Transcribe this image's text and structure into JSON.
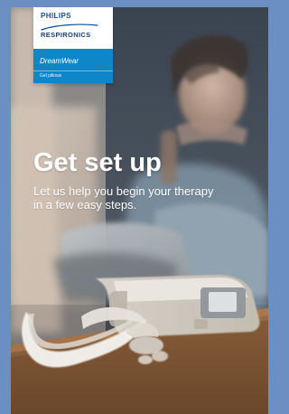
{
  "branding": {
    "company": "PHILIPS",
    "subbrand": "RESPIRONICS",
    "product": "DreamWear",
    "variant": "Gel pillows"
  },
  "hero": {
    "title": "Get set up",
    "subtitle": "Let us help you begin your therapy in a few easy steps."
  },
  "visual": {
    "background_frame": "#6b8fc2",
    "brand_blue": "#0f86c8",
    "photo_icon": "setup-photo"
  }
}
